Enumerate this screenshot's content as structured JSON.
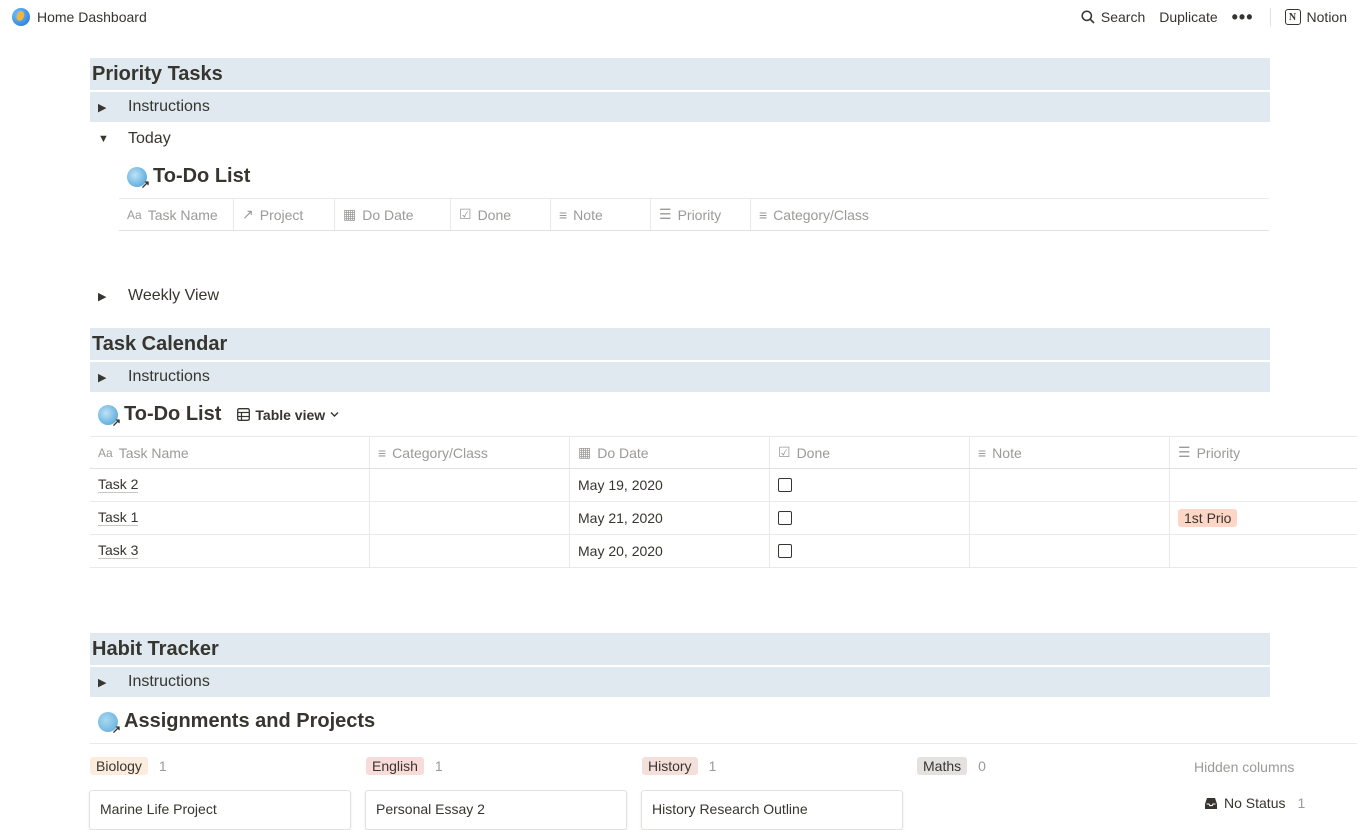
{
  "topbar": {
    "page_title": "Home Dashboard",
    "search_label": "Search",
    "duplicate_label": "Duplicate",
    "more_label": "•••",
    "notion_label": "Notion"
  },
  "priority_tasks": {
    "heading": "Priority Tasks",
    "instructions": "Instructions",
    "today": "Today",
    "todo_title": "To-Do List",
    "columns": [
      "Task Name",
      "Project",
      "Do Date",
      "Done",
      "Note",
      "Priority",
      "Category/Class"
    ],
    "weekly": "Weekly View"
  },
  "task_calendar": {
    "heading": "Task Calendar",
    "instructions": "Instructions",
    "todo_title": "To-Do List",
    "view_label": "Table view",
    "columns": [
      "Task Name",
      "Category/Class",
      "Do Date",
      "Done",
      "Note",
      "Priority"
    ],
    "rows": [
      {
        "name": "Task 2",
        "category": "",
        "date": "May 19, 2020",
        "done": false,
        "note": "",
        "priority": ""
      },
      {
        "name": "Task 1",
        "category": "",
        "date": "May 21, 2020",
        "done": false,
        "note": "",
        "priority": "1st Prio"
      },
      {
        "name": "Task 3",
        "category": "",
        "date": "May 20, 2020",
        "done": false,
        "note": "",
        "priority": ""
      }
    ]
  },
  "habit_tracker": {
    "heading": "Habit Tracker",
    "instructions": "Instructions",
    "board_title": "Assignments and Projects",
    "groups": [
      {
        "label": "Biology",
        "count": "1",
        "color": "#fbecdd",
        "card": "Marine Life Project"
      },
      {
        "label": "English",
        "count": "1",
        "color": "#f9dcda",
        "card": "Personal Essay 2"
      },
      {
        "label": "History",
        "count": "1",
        "color": "#f4dfdb",
        "card": "History Research Outline"
      },
      {
        "label": "Maths",
        "count": "0",
        "color": "#e3e2e0",
        "card": ""
      }
    ],
    "hidden_columns": "Hidden columns",
    "no_status": "No Status",
    "no_status_count": "1"
  },
  "colors": {
    "band": "#dfe9ef",
    "priority_pill": "#fdd6c6"
  }
}
